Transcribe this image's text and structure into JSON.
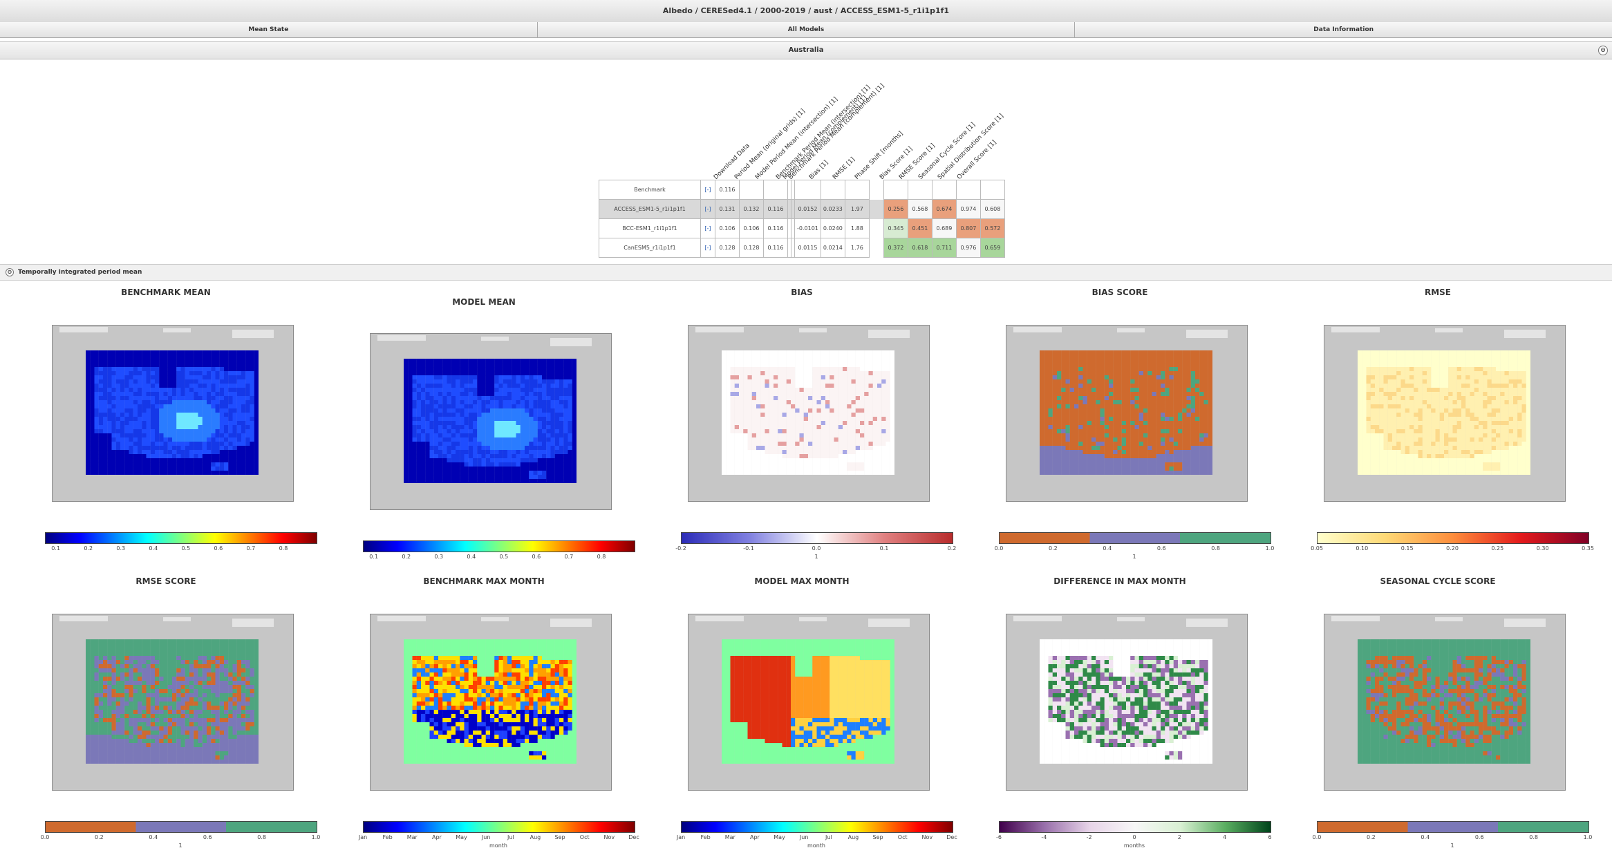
{
  "header": {
    "title": "Albedo / CERESed4.1 / 2000-2019 / aust / ACCESS_ESM1-5_r1i1p1f1"
  },
  "tabs": [
    "Mean State",
    "All Models",
    "Data Information"
  ],
  "region": {
    "label": "Australia",
    "toggle_icon": "collapse-icon"
  },
  "table": {
    "columns": [
      "Download Data",
      "Period Mean (original grids) [1]",
      "Model Period Mean (intersection) [1]",
      "Benchmark Period Mean (intersection) [1]",
      "Model Period Mean (complement) [1]",
      "Benchmark Period Mean (complement) [1]",
      "Bias [1]",
      "RMSE [1]",
      "Phase Shift [months]",
      "Bias Score [1]",
      "RMSE Score [1]",
      "Seasonal Cycle Score [1]",
      "Spatial Distribution Score [1]",
      "Overall Score [1]"
    ],
    "rows": [
      {
        "name": "Benchmark",
        "dl": "[-]",
        "vals": [
          "0.116",
          "",
          "",
          "",
          "",
          "",
          "",
          ""
        ],
        "scores": [
          "",
          "",
          "",
          "",
          ""
        ],
        "highlight": false
      },
      {
        "name": "ACCESS_ESM1-5_r1i1p1f1",
        "dl": "[-]",
        "vals": [
          "0.131",
          "0.132",
          "0.116",
          "",
          "",
          "0.0152",
          "0.0233",
          "1.97"
        ],
        "scores": [
          "0.256",
          "0.568",
          "0.674",
          "0.974",
          "0.608"
        ],
        "highlight": true
      },
      {
        "name": "BCC-ESM1_r1i1p1f1",
        "dl": "[-]",
        "vals": [
          "0.106",
          "0.106",
          "0.116",
          "",
          "",
          "-0.0101",
          "0.0240",
          "1.88"
        ],
        "scores": [
          "0.345",
          "0.451",
          "0.689",
          "0.807",
          "0.572"
        ],
        "highlight": false
      },
      {
        "name": "CanESM5_r1i1p1f1",
        "dl": "[-]",
        "vals": [
          "0.128",
          "0.128",
          "0.116",
          "",
          "",
          "0.0115",
          "0.0214",
          "1.76"
        ],
        "scores": [
          "0.372",
          "0.618",
          "0.711",
          "0.976",
          "0.659"
        ],
        "highlight": false
      }
    ],
    "score_colors": [
      [
        "#ffffff",
        "#ffffff",
        "#ffffff",
        "#ffffff",
        "#ffffff"
      ],
      [
        "#e9a07c",
        "#f7f7f7",
        "#e9a07c",
        "#f7f7f7",
        "#f7f7f7"
      ],
      [
        "#d7ebd2",
        "#e9a07c",
        "#f7f7f7",
        "#e9a07c",
        "#e9a07c"
      ],
      [
        "#a8d69b",
        "#a8d69b",
        "#a8d69b",
        "#f7f7f7",
        "#a8d69b"
      ]
    ]
  },
  "section": {
    "label": "Temporally integrated period mean",
    "toggle_icon": "collapse-icon"
  },
  "panels": [
    {
      "title": "BENCHMARK MEAN",
      "map": "blue",
      "cmap": "jet",
      "ticks": [
        "0.1",
        "0.2",
        "0.3",
        "0.4",
        "0.5",
        "0.6",
        "0.7",
        "0.8"
      ],
      "label": ""
    },
    {
      "title": "MODEL MEAN",
      "map": "blue2",
      "cmap": "jet",
      "ticks": [
        "0.1",
        "0.2",
        "0.3",
        "0.4",
        "0.5",
        "0.6",
        "0.7",
        "0.8"
      ],
      "label": ""
    },
    {
      "title": "BIAS",
      "map": "bias",
      "cmap": "bwr",
      "ticks": [
        "-0.2",
        "-0.1",
        "0.0",
        "0.1",
        "0.2"
      ],
      "label": "1"
    },
    {
      "title": "BIAS SCORE",
      "map": "biasscore",
      "cmap": "score",
      "ticks": [
        "0.0",
        "0.2",
        "0.4",
        "0.6",
        "0.8",
        "1.0"
      ],
      "label": "1"
    },
    {
      "title": "RMSE",
      "map": "rmse",
      "cmap": "ylorrd",
      "ticks": [
        "0.05",
        "0.10",
        "0.15",
        "0.20",
        "0.25",
        "0.30",
        "0.35"
      ],
      "label": ""
    },
    {
      "title": "RMSE SCORE",
      "map": "rmsescore",
      "cmap": "score",
      "ticks": [
        "0.0",
        "0.2",
        "0.4",
        "0.6",
        "0.8",
        "1.0"
      ],
      "label": "1"
    },
    {
      "title": "BENCHMARK MAX MONTH",
      "map": "maxmonth",
      "cmap": "jet",
      "ticks": [
        "Jan",
        "Feb",
        "Mar",
        "Apr",
        "May",
        "Jun",
        "Jul",
        "Aug",
        "Sep",
        "Oct",
        "Nov",
        "Dec"
      ],
      "label": "month"
    },
    {
      "title": "MODEL MAX MONTH",
      "map": "modelmonth",
      "cmap": "jet",
      "ticks": [
        "Jan",
        "Feb",
        "Mar",
        "Apr",
        "May",
        "Jun",
        "Jul",
        "Aug",
        "Sep",
        "Oct",
        "Nov",
        "Dec"
      ],
      "label": "month"
    },
    {
      "title": "DIFFERENCE IN MAX MONTH",
      "map": "diff",
      "cmap": "prgn",
      "ticks": [
        "-6",
        "-4",
        "-2",
        "0",
        "2",
        "4",
        "6"
      ],
      "label": "months"
    },
    {
      "title": "SEASONAL CYCLE SCORE",
      "map": "seasonal",
      "cmap": "score",
      "ticks": [
        "0.0",
        "0.2",
        "0.4",
        "0.6",
        "0.8",
        "1.0"
      ],
      "label": "1"
    }
  ]
}
